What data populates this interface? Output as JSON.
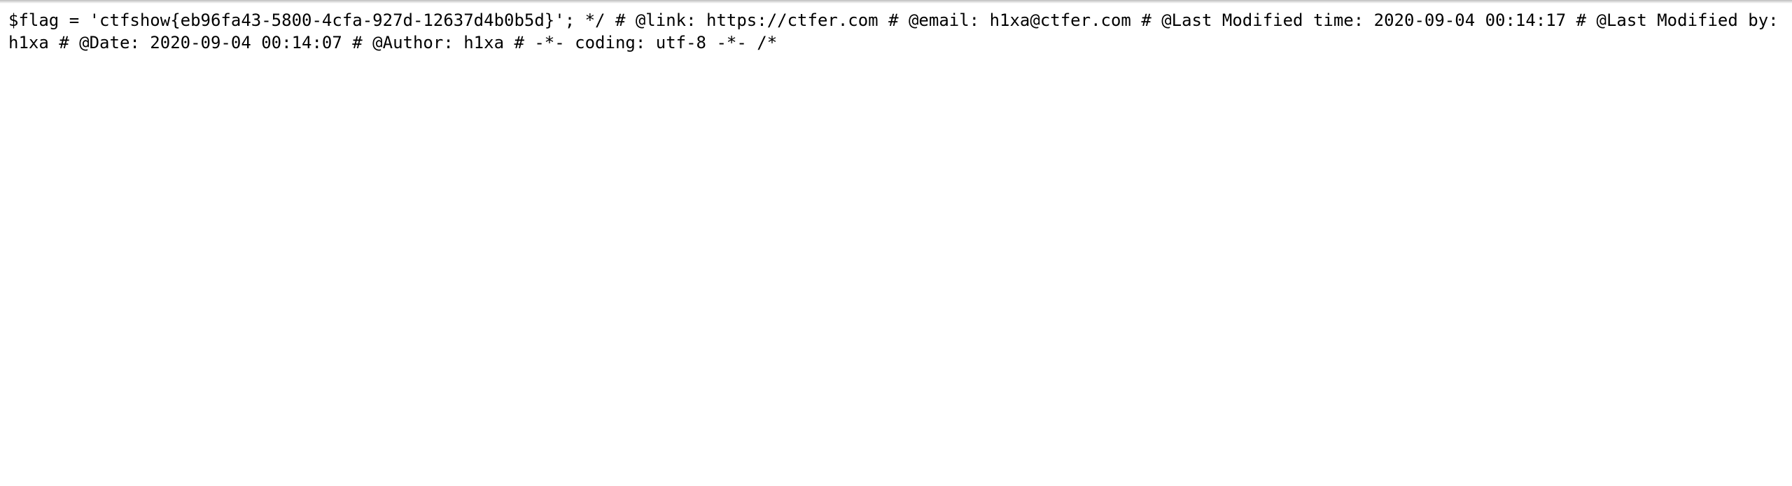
{
  "page": {
    "text": "$flag = 'ctfshow{eb96fa43-5800-4cfa-927d-12637d4b0b5d}'; */ # @link: https://ctfer.com # @email: h1xa@ctfer.com # @Last Modified time: 2020-09-04 00:14:17 # @Last Modified by: h1xa # @Date: 2020-09-04 00:14:07 # @Author: h1xa # -*- coding: utf-8 -*- /*"
  }
}
